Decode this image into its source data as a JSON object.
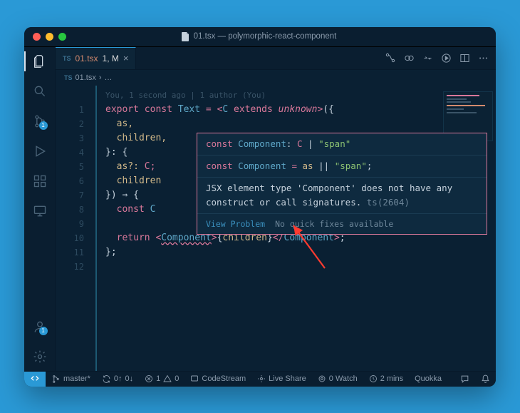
{
  "window": {
    "title": "01.tsx — polymorphic-react-component",
    "traffic_colors": {
      "close": "#ff5f57",
      "min": "#febc2e",
      "max": "#28c840"
    }
  },
  "activity": {
    "source_control_badge": "1",
    "accounts_badge": "1"
  },
  "tabs": [
    {
      "lang": "TS",
      "name": "01.tsx",
      "status": "1, M"
    }
  ],
  "breadcrumbs": {
    "lang": "TS",
    "file": "01.tsx",
    "sep": "›",
    "more": "…"
  },
  "blame": "You, 1 second ago | 1 author (You)",
  "code": {
    "l1": {
      "export": "export",
      "const": "const",
      "Text": "Text",
      "eq": "=",
      "lt": "<",
      "C": "C",
      "extends": "extends",
      "unknown": "unknown",
      "gt": ">",
      "lp": "({"
    },
    "l2": "as,",
    "l3": "children,",
    "l4_a": "}: {",
    "l4_b": "",
    "l5_a": "as?:",
    "l5_b": "C;",
    "l6": "children",
    "l7": "}) ⇒ {",
    "l8_a": "const",
    "l8_b": "C",
    "l10_a": "return",
    "l10_b": "Component",
    "l10_c": "children",
    "l10_d": "Component",
    "l11": "};"
  },
  "line_numbers": [
    "1",
    "2",
    "3",
    "4",
    "5",
    "6",
    "7",
    "8",
    "9",
    "10",
    "11",
    "12"
  ],
  "hover": {
    "sig_kw": "const",
    "sig_name": "Component",
    "sig_colon": ":",
    "sig_type_a": "C",
    "sig_pipe": "|",
    "sig_type_b": "\"span\"",
    "src_kw": "const",
    "src_name": "Component",
    "src_eq": "=",
    "src_a": "as",
    "src_or": "||",
    "src_b": "\"span\"",
    "src_end": ";",
    "error": "JSX element type 'Component' does not have any construct or call signatures.",
    "tsnum": "ts(2604)",
    "view_problem": "View Problem",
    "no_fix": "No quick fixes available"
  },
  "status": {
    "branch": "master*",
    "sync_up": "0↑",
    "sync_down": "0↓",
    "errors": "1",
    "warnings": "0",
    "codestream": "CodeStream",
    "liveshare": "Live Share",
    "watch": "0 Watch",
    "time": "2 mins",
    "quokka": "Quokka"
  }
}
